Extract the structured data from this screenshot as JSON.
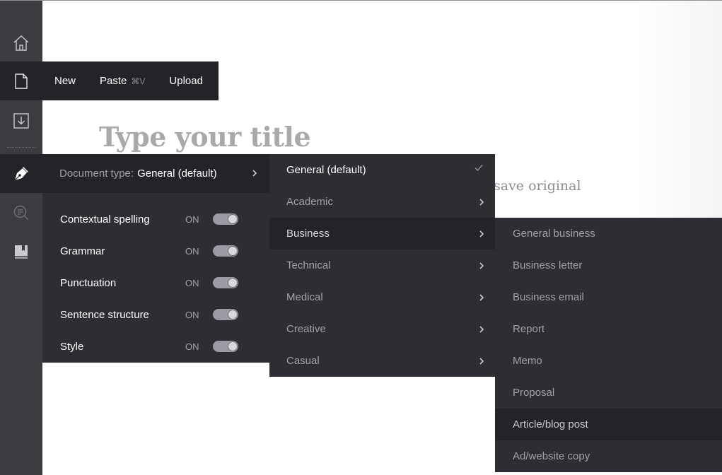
{
  "rail": {
    "icons": [
      "home-icon",
      "document-icon",
      "download-icon",
      "pen-nib-icon",
      "search-text-icon",
      "book-icon"
    ]
  },
  "file_menu": {
    "new_label": "New",
    "paste_label": "Paste",
    "paste_shortcut": "⌘V",
    "upload_label": "Upload"
  },
  "editor": {
    "title_placeholder": "Type your title",
    "hint_fragment": "save original"
  },
  "settings": {
    "doc_type_label": "Document type:",
    "doc_type_value": "General (default)",
    "toggles": [
      {
        "name": "Contextual spelling",
        "state": "ON"
      },
      {
        "name": "Grammar",
        "state": "ON"
      },
      {
        "name": "Punctuation",
        "state": "ON"
      },
      {
        "name": "Sentence structure",
        "state": "ON"
      },
      {
        "name": "Style",
        "state": "ON"
      }
    ]
  },
  "doc_types": {
    "items": [
      {
        "label": "General (default)"
      },
      {
        "label": "Academic"
      },
      {
        "label": "Business"
      },
      {
        "label": "Technical"
      },
      {
        "label": "Medical"
      },
      {
        "label": "Creative"
      },
      {
        "label": "Casual"
      }
    ]
  },
  "business_types": {
    "items": [
      {
        "label": "General business"
      },
      {
        "label": "Business letter"
      },
      {
        "label": "Business email"
      },
      {
        "label": "Report"
      },
      {
        "label": "Memo"
      },
      {
        "label": "Proposal"
      },
      {
        "label": "Article/blog post"
      },
      {
        "label": "Ad/website copy"
      }
    ]
  },
  "colors": {
    "rail_bg": "#3b3c41",
    "menu_bg": "#2d2e33",
    "menu_active_bg": "#232428",
    "text_primary": "#ffffff",
    "text_muted": "#a1a2a8"
  }
}
